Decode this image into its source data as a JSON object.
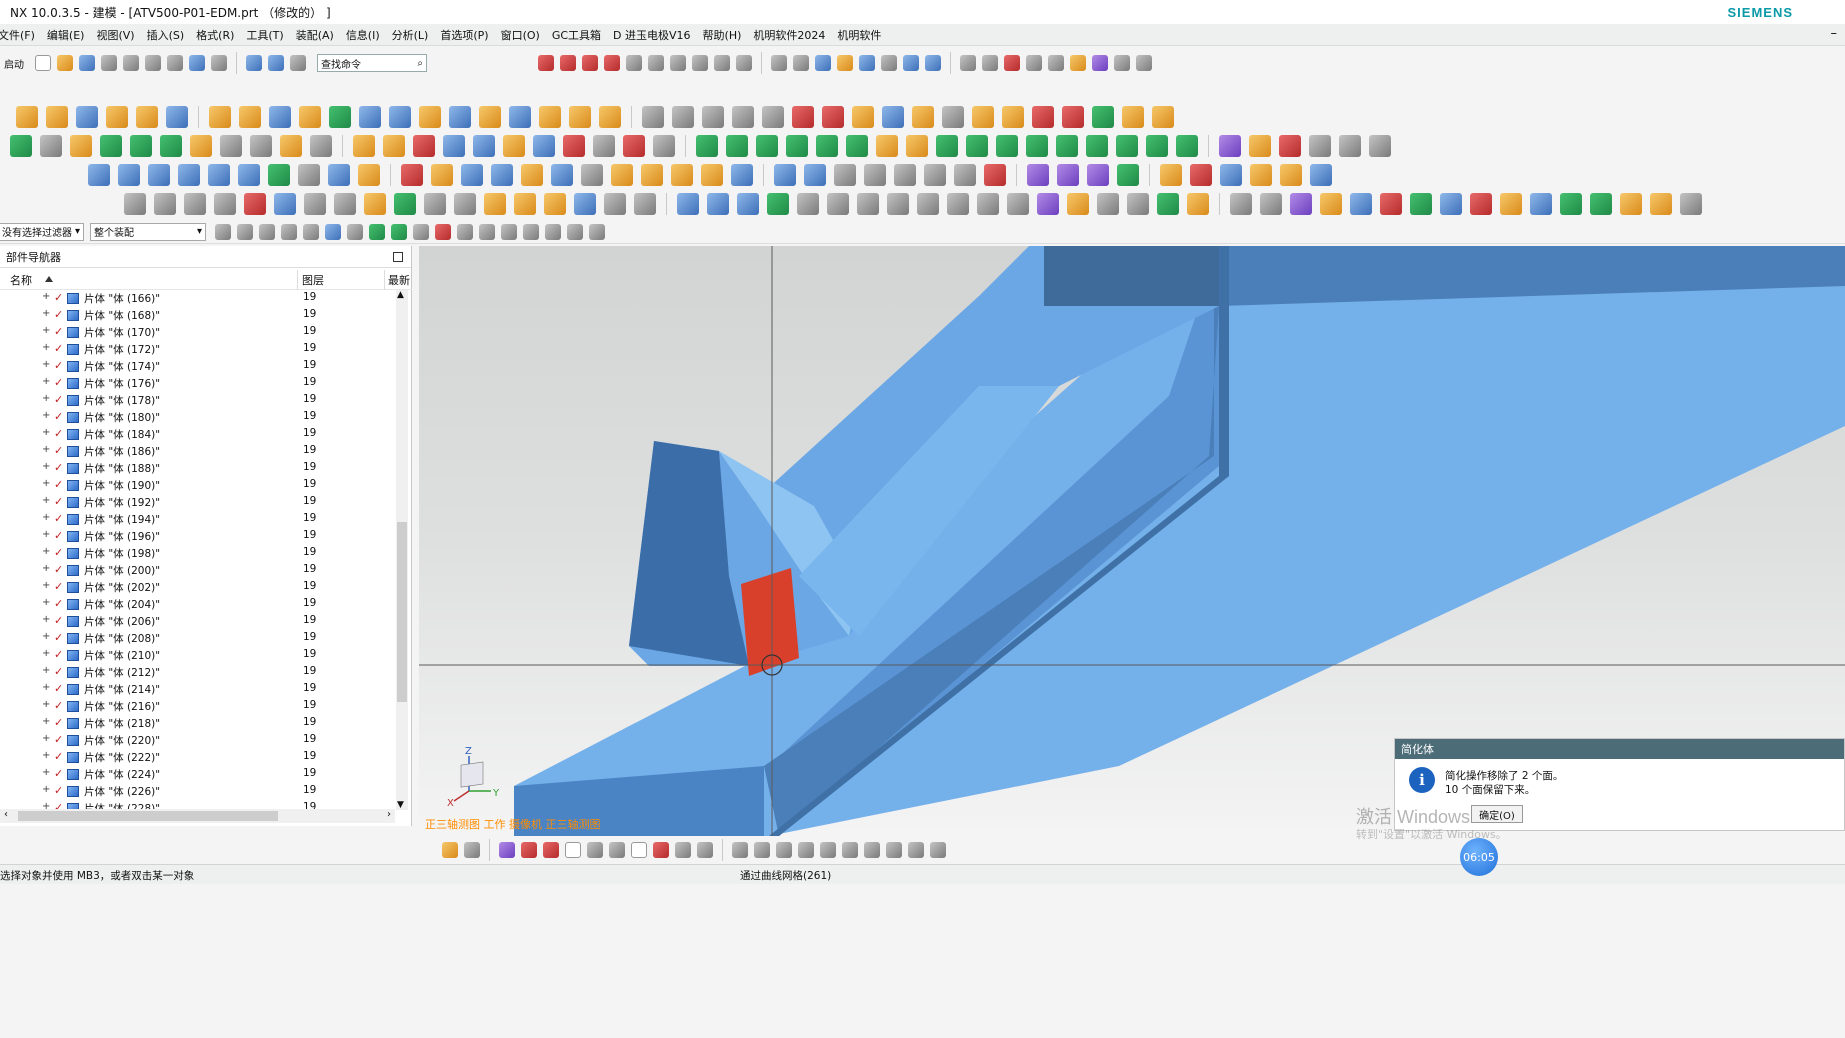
{
  "window": {
    "title": "NX 10.0.3.5 - 建模 - [ATV500-P01-EDM.prt （修改的） ]",
    "brand": "SIEMENS"
  },
  "menu": [
    "文件(F)",
    "编辑(E)",
    "视图(V)",
    "插入(S)",
    "格式(R)",
    "工具(T)",
    "装配(A)",
    "信息(I)",
    "分析(L)",
    "首选项(P)",
    "窗口(O)",
    "GC工具箱",
    "D 进玉电极V16",
    "帮助(H)",
    "机明软件2024",
    "机明软件"
  ],
  "toolbar": {
    "start_label": "启动",
    "search_placeholder": "查找命令"
  },
  "selection_bar": {
    "filter_value": "没有选择过滤器",
    "scope_value": "整个装配"
  },
  "navigator": {
    "title": "部件导航器",
    "columns": {
      "name": "名称",
      "layer": "图层",
      "latest": "最新"
    },
    "rows": [
      {
        "name": "片体 \"体 (166)\"",
        "layer": "19"
      },
      {
        "name": "片体 \"体 (168)\"",
        "layer": "19"
      },
      {
        "name": "片体 \"体 (170)\"",
        "layer": "19"
      },
      {
        "name": "片体 \"体 (172)\"",
        "layer": "19"
      },
      {
        "name": "片体 \"体 (174)\"",
        "layer": "19"
      },
      {
        "name": "片体 \"体 (176)\"",
        "layer": "19"
      },
      {
        "name": "片体 \"体 (178)\"",
        "layer": "19"
      },
      {
        "name": "片体 \"体 (180)\"",
        "layer": "19"
      },
      {
        "name": "片体 \"体 (184)\"",
        "layer": "19"
      },
      {
        "name": "片体 \"体 (186)\"",
        "layer": "19"
      },
      {
        "name": "片体 \"体 (188)\"",
        "layer": "19"
      },
      {
        "name": "片体 \"体 (190)\"",
        "layer": "19"
      },
      {
        "name": "片体 \"体 (192)\"",
        "layer": "19"
      },
      {
        "name": "片体 \"体 (194)\"",
        "layer": "19"
      },
      {
        "name": "片体 \"体 (196)\"",
        "layer": "19"
      },
      {
        "name": "片体 \"体 (198)\"",
        "layer": "19"
      },
      {
        "name": "片体 \"体 (200)\"",
        "layer": "19"
      },
      {
        "name": "片体 \"体 (202)\"",
        "layer": "19"
      },
      {
        "name": "片体 \"体 (204)\"",
        "layer": "19"
      },
      {
        "name": "片体 \"体 (206)\"",
        "layer": "19"
      },
      {
        "name": "片体 \"体 (208)\"",
        "layer": "19"
      },
      {
        "name": "片体 \"体 (210)\"",
        "layer": "19"
      },
      {
        "name": "片体 \"体 (212)\"",
        "layer": "19"
      },
      {
        "name": "片体 \"体 (214)\"",
        "layer": "19"
      },
      {
        "name": "片体 \"体 (216)\"",
        "layer": "19"
      },
      {
        "name": "片体 \"体 (218)\"",
        "layer": "19"
      },
      {
        "name": "片体 \"体 (220)\"",
        "layer": "19"
      },
      {
        "name": "片体 \"体 (222)\"",
        "layer": "19"
      },
      {
        "name": "片体 \"体 (224)\"",
        "layer": "19"
      },
      {
        "name": "片体 \"体 (226)\"",
        "layer": "19"
      },
      {
        "name": "片体 \"体 (228)\"",
        "layer": "19"
      }
    ]
  },
  "viewport": {
    "view_label": "正三轴测图 工作 摄像机 正三轴测图",
    "triad_z": "Z",
    "triad_x": "X",
    "triad_y": "Y",
    "body_color": "#4a84c4",
    "highlight_color": "#d9402c"
  },
  "status": {
    "left": "选择对象并使用 MB3，或者双击某一对象",
    "middle": "通过曲线网格(261)"
  },
  "dialog": {
    "title": "简化体",
    "line1": "简化操作移除了 2 个面。",
    "line2": "10 个面保留下来。",
    "ok_label": "确定(O)"
  },
  "watermark": {
    "line1": "激活 Windows",
    "line2": "转到\"设置\"以激活 Windows。"
  },
  "timer": "06:05"
}
